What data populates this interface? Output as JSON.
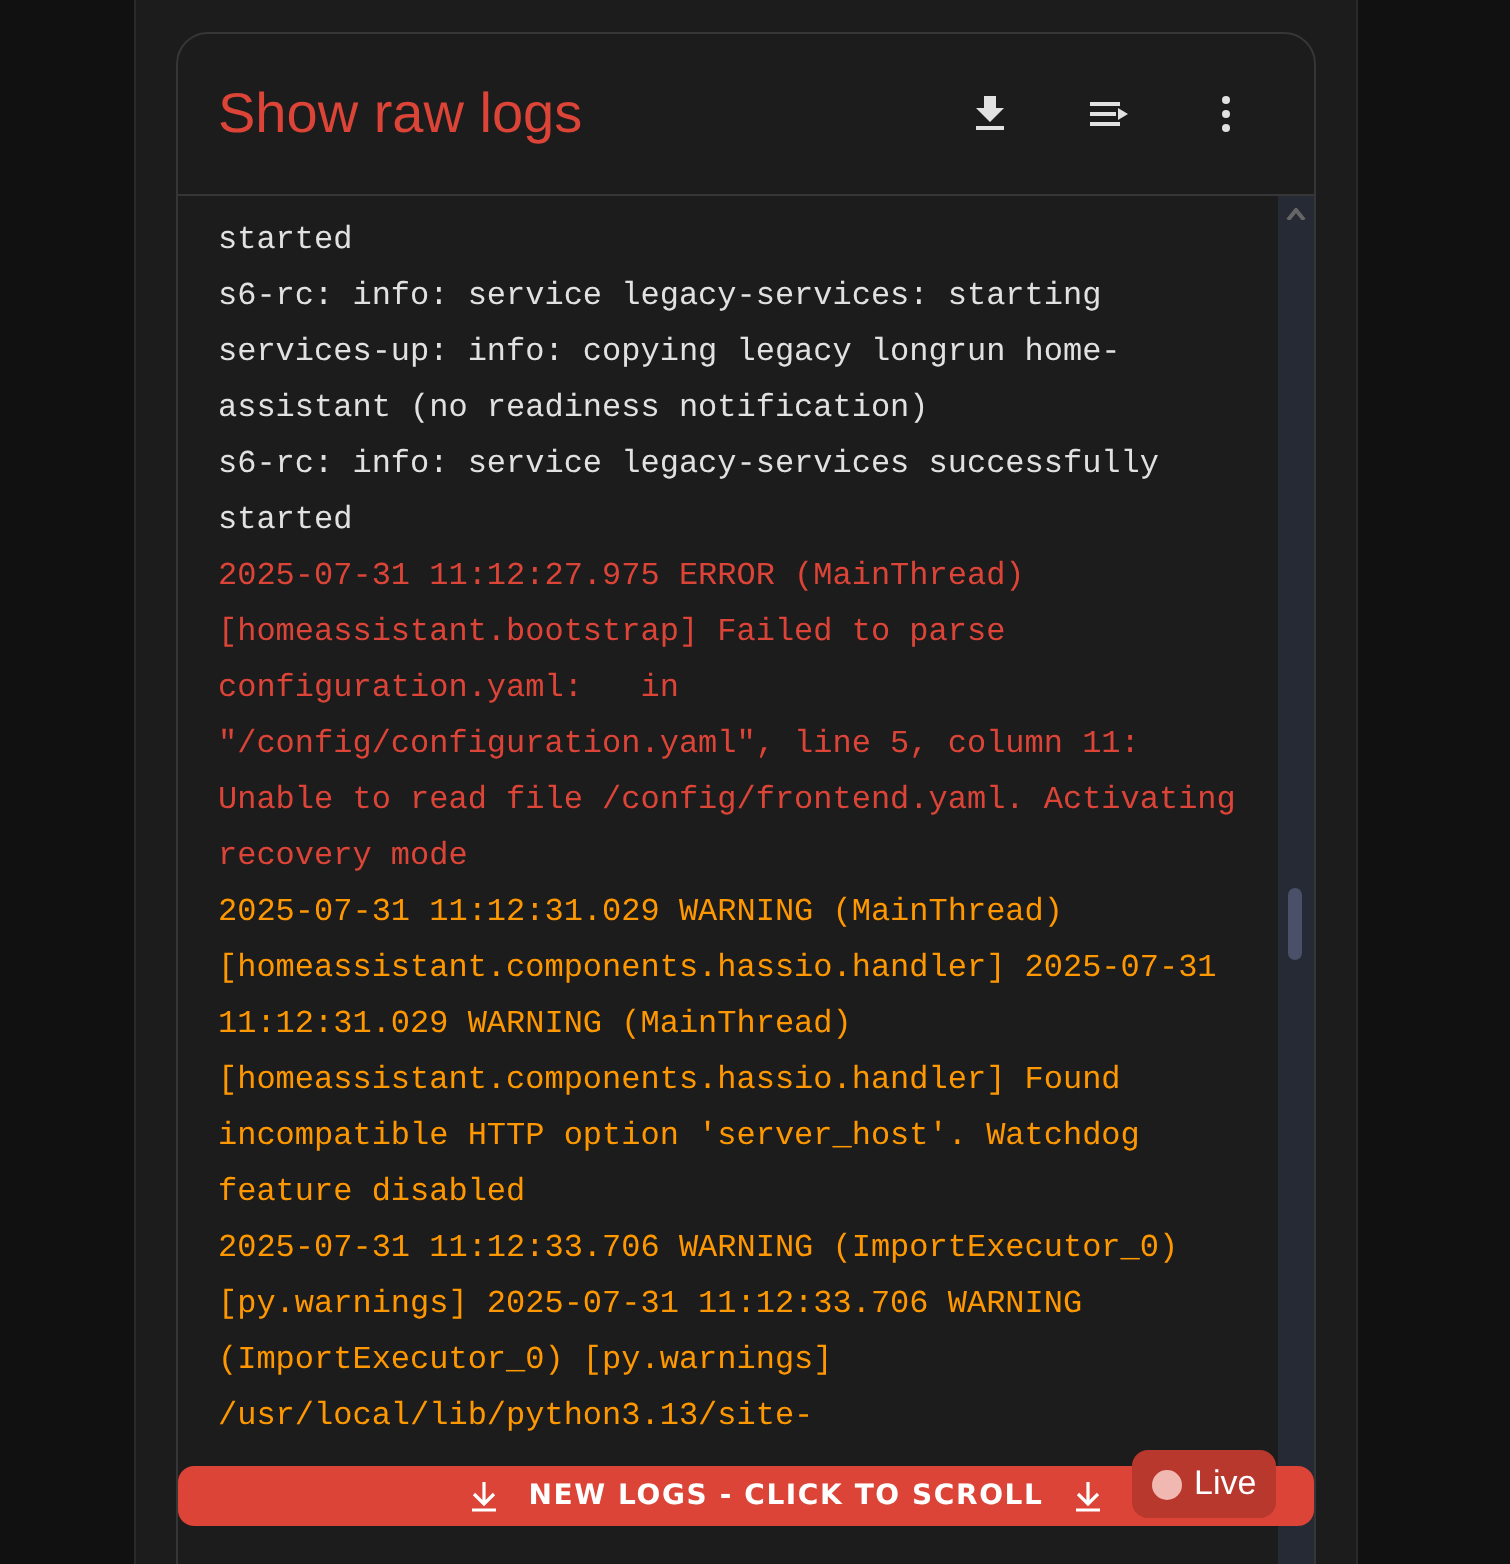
{
  "card": {
    "title": "Show raw logs"
  },
  "log_lines": [
    {
      "kind": "info",
      "text": "started"
    },
    {
      "kind": "info",
      "text": "s6-rc: info: service legacy-services: starting"
    },
    {
      "kind": "info",
      "text": "services-up: info: copying legacy longrun home-"
    },
    {
      "kind": "info",
      "text": "assistant (no readiness notification)"
    },
    {
      "kind": "info",
      "text": "s6-rc: info: service legacy-services successfully"
    },
    {
      "kind": "info",
      "text": "started"
    },
    {
      "kind": "error",
      "text": "2025-07-31 11:12:27.975 ERROR (MainThread)"
    },
    {
      "kind": "error",
      "text": "[homeassistant.bootstrap] Failed to parse"
    },
    {
      "kind": "error",
      "text": "configuration.yaml:   in"
    },
    {
      "kind": "error",
      "text": "\"/config/configuration.yaml\", line 5, column 11:"
    },
    {
      "kind": "error",
      "text": "Unable to read file /config/frontend.yaml. Activating"
    },
    {
      "kind": "error",
      "text": "recovery mode"
    },
    {
      "kind": "warning",
      "text": "2025-07-31 11:12:31.029 WARNING (MainThread)"
    },
    {
      "kind": "warning",
      "text": "[homeassistant.components.hassio.handler] 2025-07-31"
    },
    {
      "kind": "warning",
      "text": "11:12:31.029 WARNING (MainThread)"
    },
    {
      "kind": "warning",
      "text": "[homeassistant.components.hassio.handler] Found"
    },
    {
      "kind": "warning",
      "text": "incompatible HTTP option 'server_host'. Watchdog"
    },
    {
      "kind": "warning",
      "text": "feature disabled"
    },
    {
      "kind": "warning",
      "text": "2025-07-31 11:12:33.706 WARNING (ImportExecutor_0)"
    },
    {
      "kind": "warning",
      "text": "[py.warnings] 2025-07-31 11:12:33.706 WARNING"
    },
    {
      "kind": "warning",
      "text": "(ImportExecutor_0) [py.warnings]"
    },
    {
      "kind": "warning",
      "text": "/usr/local/lib/python3.13/site-"
    }
  ],
  "new_logs_button": {
    "label": "NEW LOGS - CLICK TO SCROLL"
  },
  "live_badge": {
    "label": "Live"
  }
}
